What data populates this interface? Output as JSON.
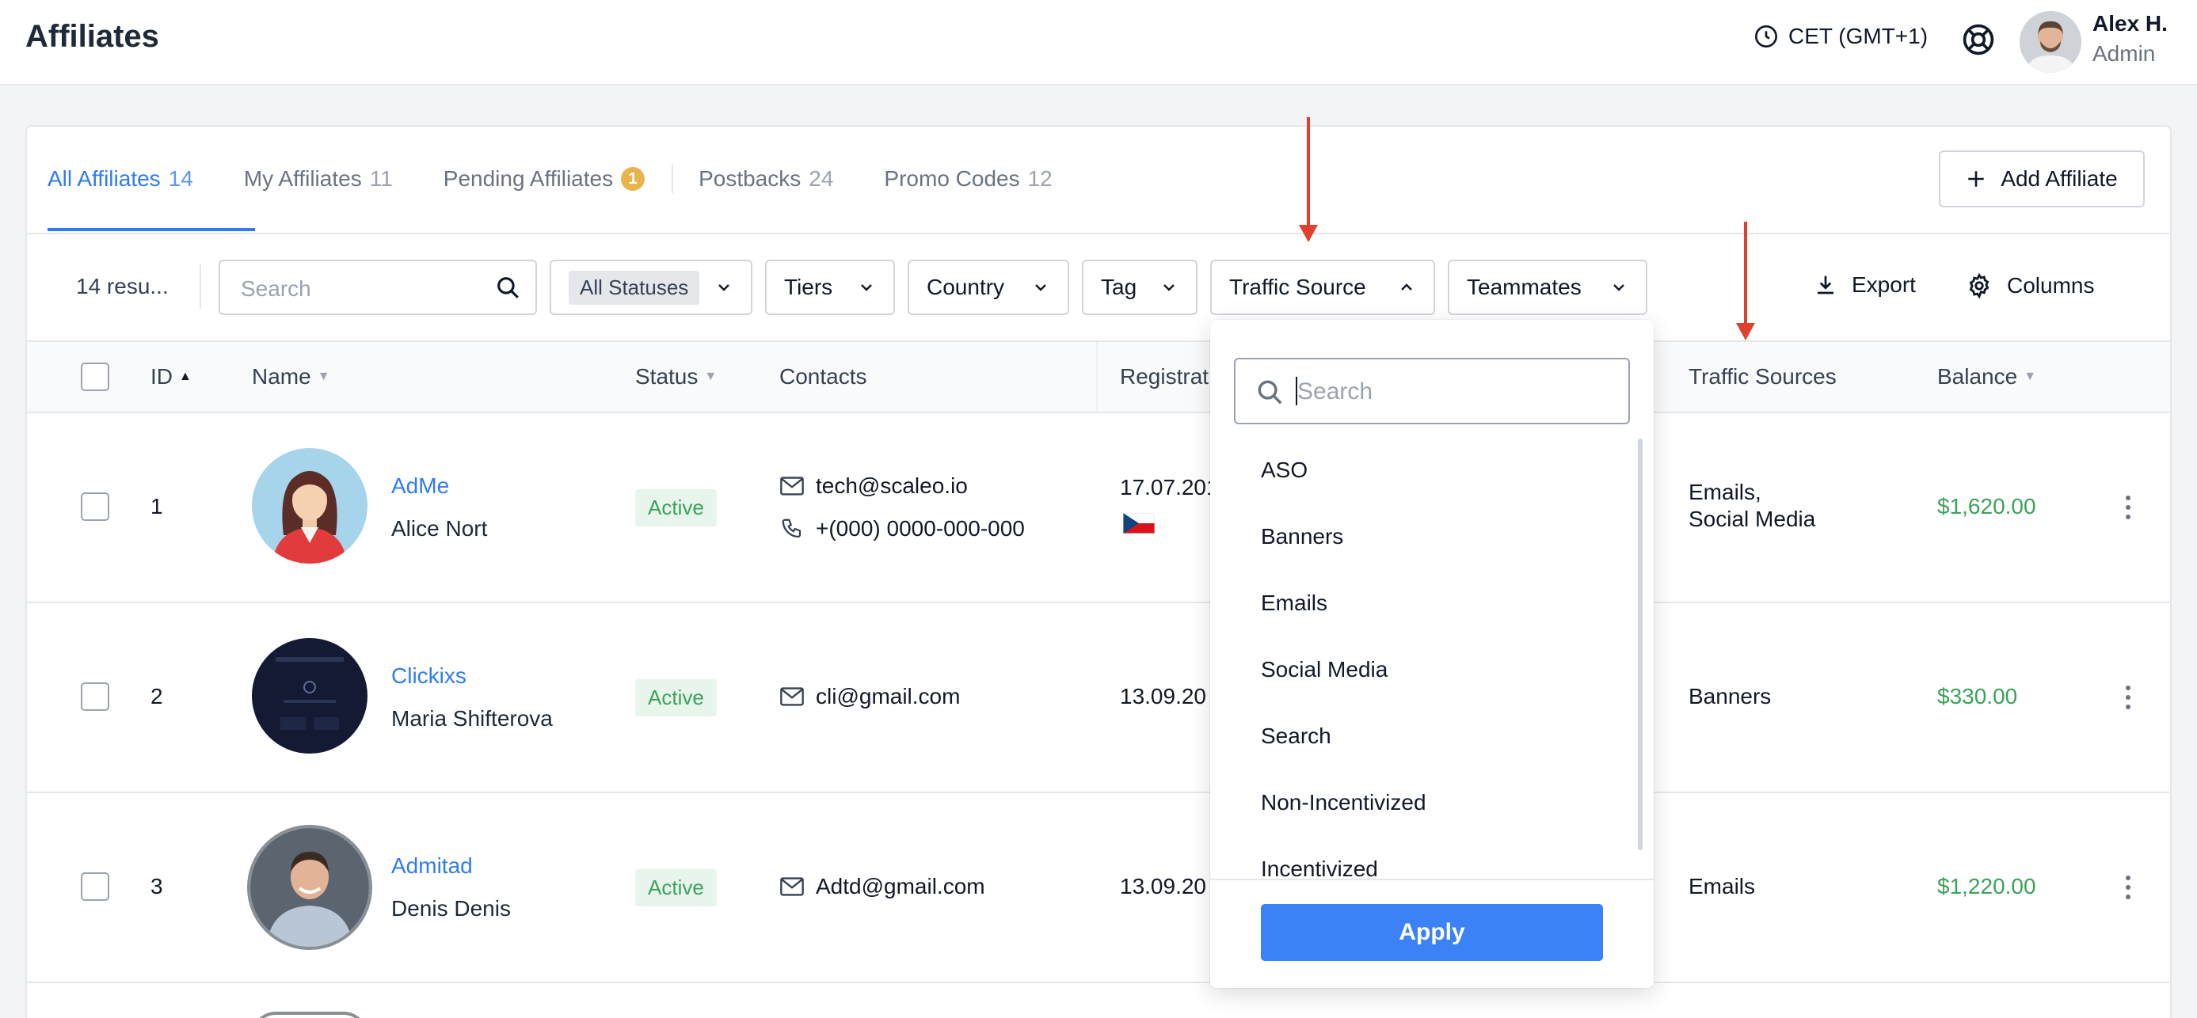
{
  "header": {
    "title": "Affiliates",
    "timezone": "CET (GMT+1)",
    "user_name": "Alex H.",
    "user_role": "Admin"
  },
  "tabs": [
    {
      "label": "All Affiliates",
      "count": "14"
    },
    {
      "label": "My Affiliates",
      "count": "11"
    },
    {
      "label": "Pending Affiliates",
      "count": "1"
    },
    {
      "label": "Postbacks",
      "count": "24"
    },
    {
      "label": "Promo Codes",
      "count": "12"
    }
  ],
  "add_button": "Add Affiliate",
  "filters": {
    "results": "14  resu...",
    "search_placeholder": "Search",
    "status": "All Statuses",
    "tiers": "Tiers",
    "country": "Country",
    "tag": "Tag",
    "traffic_source": "Traffic Source",
    "teammates": "Teammates",
    "export": "Export",
    "columns": "Columns"
  },
  "table": {
    "headers": {
      "id": "ID",
      "name": "Name",
      "status": "Status",
      "contacts": "Contacts",
      "registration": "Registrat",
      "traffic_sources": "Traffic Sources",
      "balance": "Balance"
    },
    "rows": [
      {
        "id": "1",
        "company": "AdMe",
        "person": "Alice Nort",
        "status": "Active",
        "email": "tech@scaleo.io",
        "phone": "+(000) 0000-000-000",
        "registered": "17.07.201",
        "traffic_line1": "Emails,",
        "traffic_line2": "Social Media",
        "balance": "$1,620.00"
      },
      {
        "id": "2",
        "company": "Clickixs",
        "person": "Maria Shifterova",
        "status": "Active",
        "email": "cli@gmail.com",
        "registered": "13.09.20",
        "traffic_line1": "Banners",
        "balance": "$330.00"
      },
      {
        "id": "3",
        "company": "Admitad",
        "person": "Denis Denis",
        "status": "Active",
        "email": "Adtd@gmail.com",
        "registered": "13.09.20",
        "traffic_line1": "Emails",
        "balance": "$1,220.00"
      }
    ]
  },
  "dropdown": {
    "search_placeholder": "Search",
    "options": [
      "ASO",
      "Banners",
      "Emails",
      "Social Media",
      "Search",
      "Non-Incentivized",
      "Incentivized"
    ],
    "apply": "Apply"
  },
  "colors": {
    "accent": "#2f7bf5",
    "apply_button": "#3b82f6",
    "active_badge_bg": "#e8f5ec",
    "active_badge_text": "#3aa35a",
    "money": "#3aa35a",
    "annotation_arrow": "#e0412f",
    "pending_badge": "#e9b44c"
  }
}
